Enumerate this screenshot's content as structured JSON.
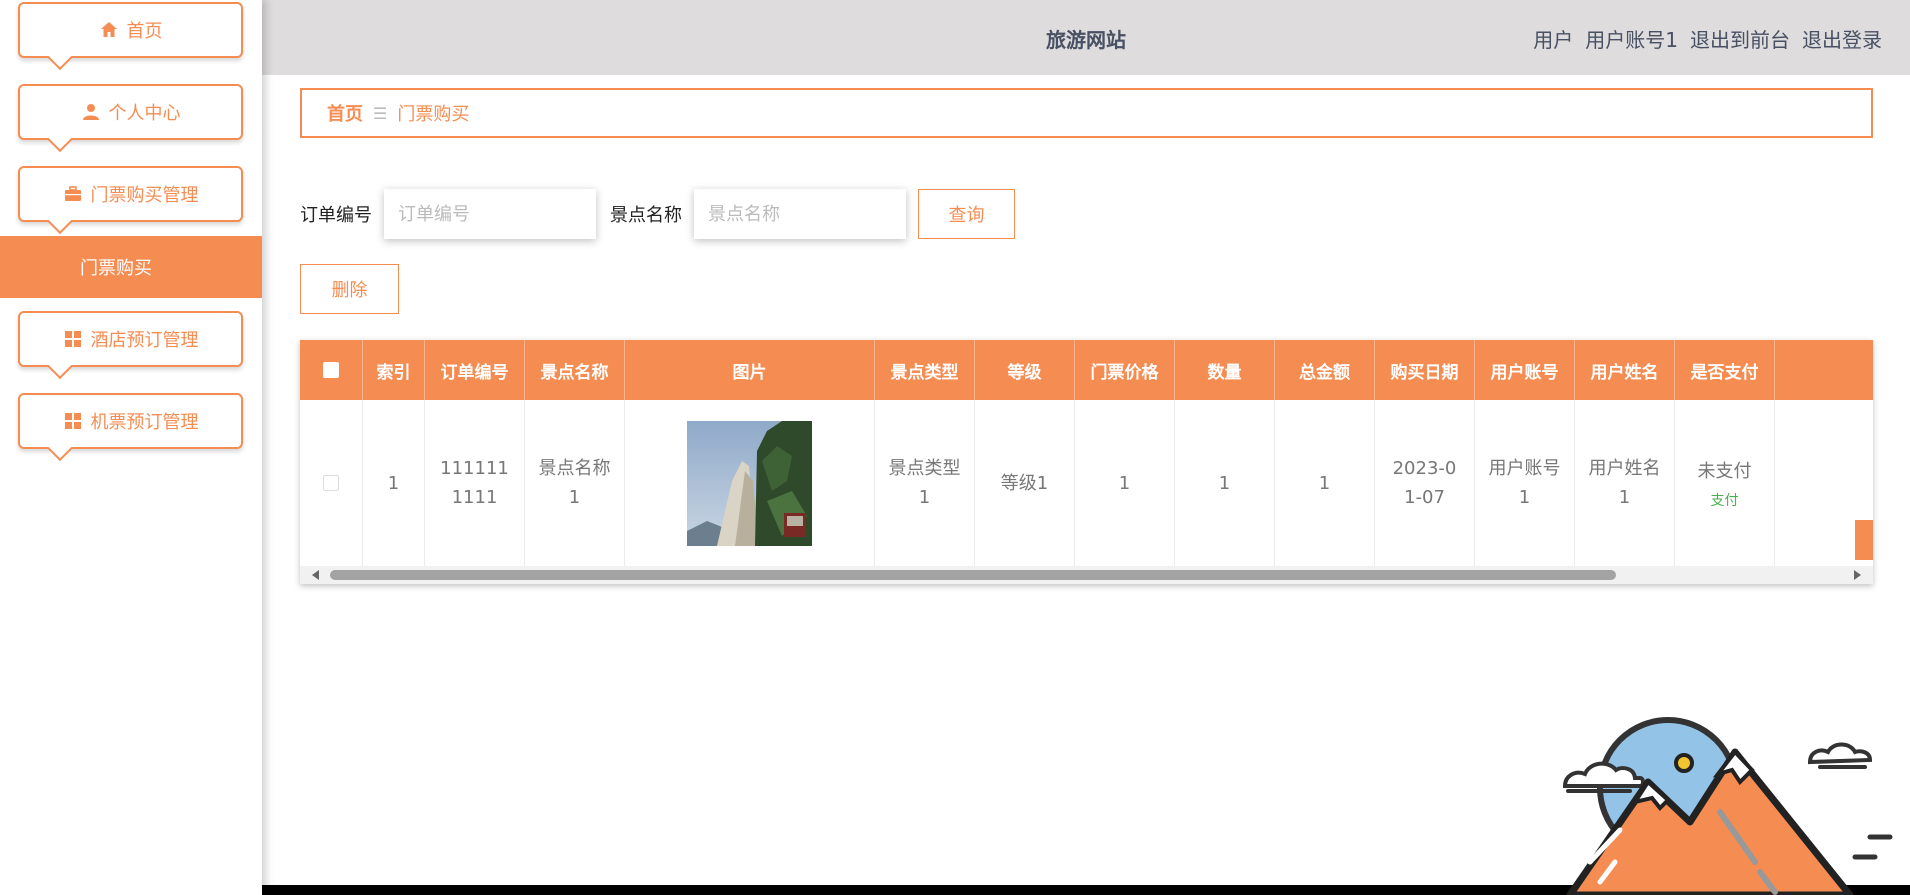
{
  "sidebar": {
    "items": [
      {
        "label": "首页",
        "icon": "home-icon"
      },
      {
        "label": "个人中心",
        "icon": "user-icon"
      },
      {
        "label": "门票购买管理",
        "icon": "briefcase-icon"
      },
      {
        "label": "酒店预订管理",
        "icon": "grid-icon"
      },
      {
        "label": "机票预订管理",
        "icon": "grid-icon"
      }
    ],
    "active_sub_item": "门票购买"
  },
  "header": {
    "title": "旅游网站",
    "user_role": "用户",
    "user_account": "用户账号1",
    "exit_front": "退出到前台",
    "logout": "退出登录"
  },
  "breadcrumb": {
    "home": "首页",
    "separator": "☰",
    "current": "门票购买"
  },
  "search": {
    "order_label": "订单编号",
    "order_placeholder": "订单编号",
    "spot_label": "景点名称",
    "spot_placeholder": "景点名称",
    "query_button": "查询"
  },
  "actions": {
    "delete_button": "删除"
  },
  "table": {
    "headers": [
      "索引",
      "订单编号",
      "景点名称",
      "图片",
      "景点类型",
      "等级",
      "门票价格",
      "数量",
      "总金额",
      "购买日期",
      "用户账号",
      "用户姓名",
      "是否支付"
    ],
    "rows": [
      {
        "index": "1",
        "order_no": "1111111111",
        "spot_name": "景点名称1",
        "image": "mountain-photo",
        "spot_type": "景点类型1",
        "level": "等级1",
        "price": "1",
        "quantity": "1",
        "total": "1",
        "date": "2023-01-07",
        "account": "用户账号1",
        "name": "用户姓名1",
        "paid": "未支付",
        "pay_action": "支付"
      }
    ]
  },
  "colors": {
    "accent": "#f58d53",
    "header_bg": "#dedcdd",
    "header_text": "#485063",
    "pay_link": "#4caf50"
  }
}
